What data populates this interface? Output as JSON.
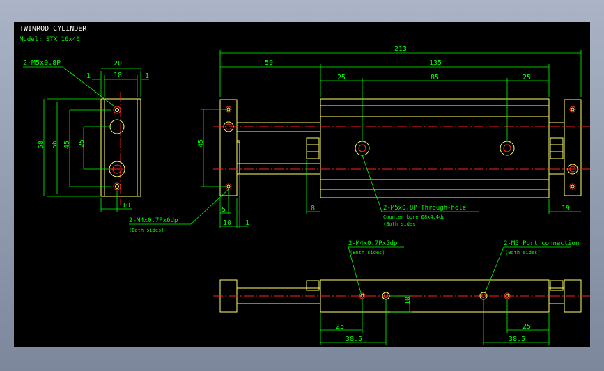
{
  "title": "TWINROD CYLINDER",
  "model": "Model: STX 16x40",
  "dims": {
    "total_length": "213",
    "left_length": "59",
    "right_length": "135",
    "seg_25a": "25",
    "seg_85": "85",
    "seg_25b": "25",
    "end_width": "20",
    "inner_width": "18",
    "margin_left": "1",
    "margin_right": "1",
    "height_58": "58",
    "height_56": "56",
    "height_45_end": "45",
    "height_25": "25",
    "bottom_10": "10",
    "height_45_side": "45",
    "side_5": "5",
    "side_10": "10",
    "side_1": "1",
    "side_8": "8",
    "side_19": "19",
    "bot_10": "10",
    "bot_25a": "25",
    "bot_38a": "38.5",
    "bot_25b": "25",
    "bot_38b": "38.5"
  },
  "notes": {
    "m5_left": "2-M5x0.8P",
    "m4_side_1": "2-M4x0.7Px6dp",
    "m4_side_2": "(Both sides)",
    "m5_through_1": "2-M5x0.8P Through-hole",
    "m5_through_2": "Counter bore Ø8x4.4dp",
    "m5_through_3": "(Both sides)",
    "m4_bottom_1": "2-M4x0.7Px5dp",
    "m4_bottom_2": "(Both sides)",
    "port_1": "2-M5 Port connection",
    "port_2": "(Both sides)"
  },
  "colors": {
    "outline": "#ffff66",
    "dimension": "#00ff00",
    "centerline": "#ff2020",
    "background": "#000000"
  }
}
